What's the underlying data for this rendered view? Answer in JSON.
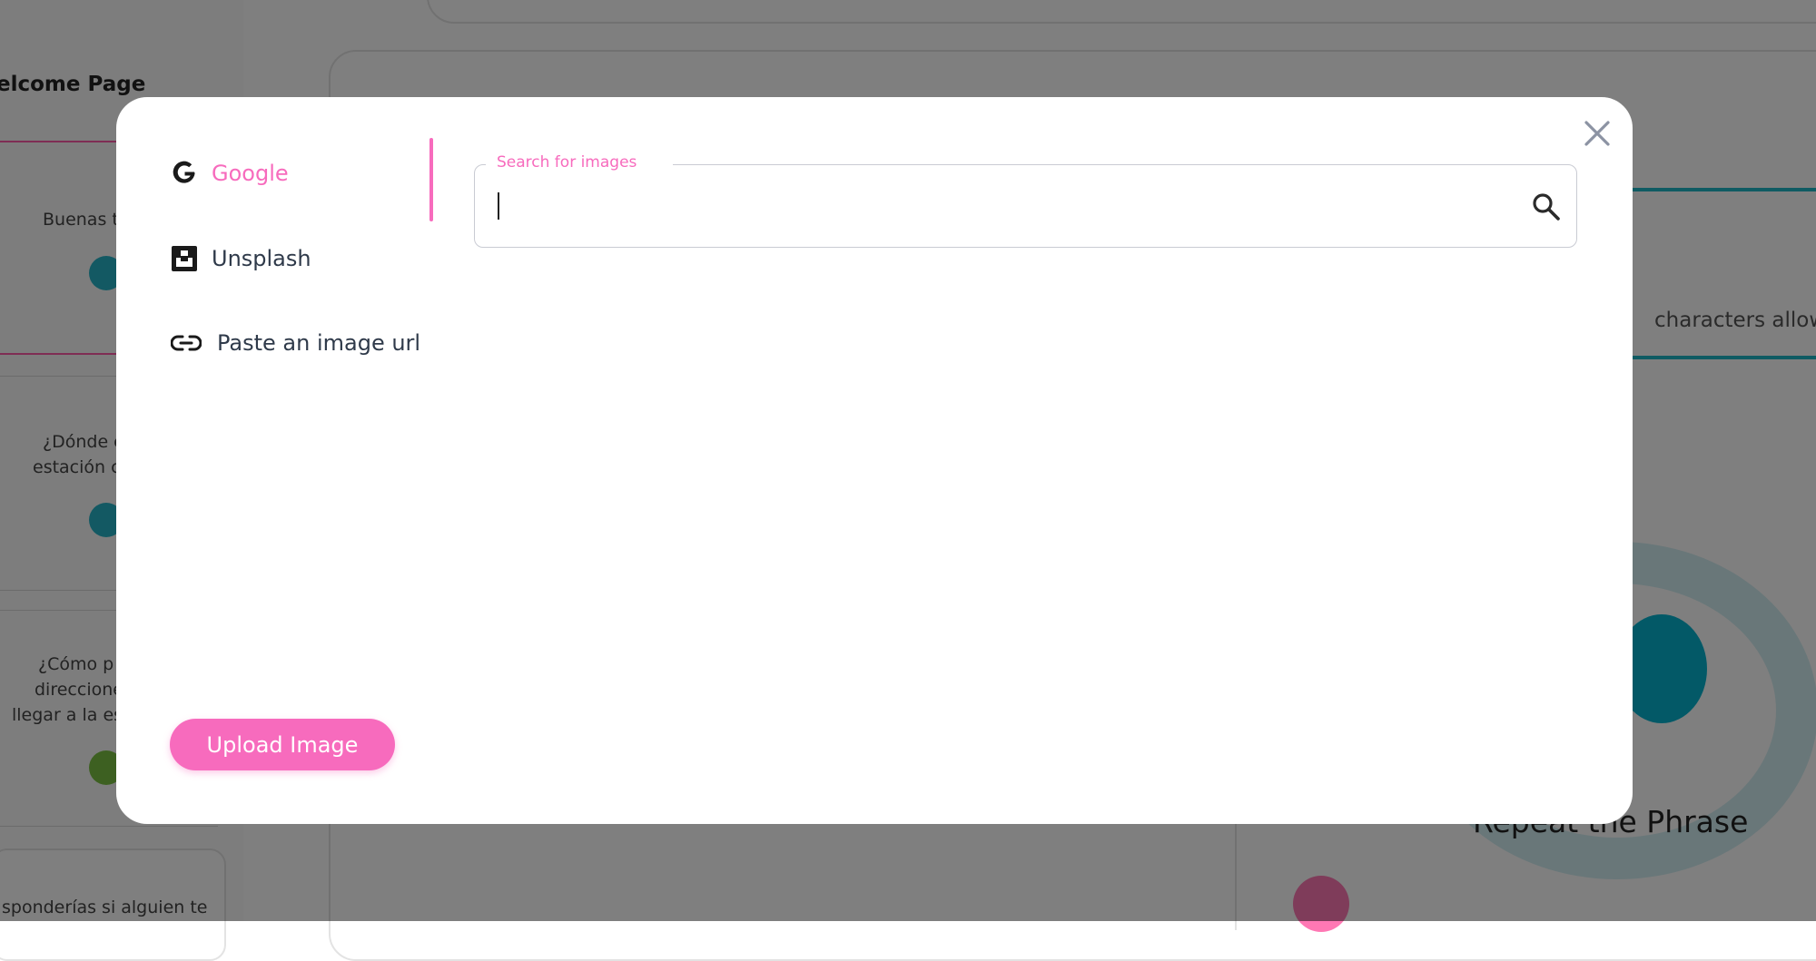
{
  "background": {
    "sidebar_title": "elcome Page",
    "cards": [
      {
        "text": "Buenas t"
      },
      {
        "line1": "¿Dónde e",
        "line2": "estación c"
      },
      {
        "line1": "¿Cómo p",
        "line2": "direccione",
        "line3": "llegar a la es"
      },
      {
        "text": "sponderías si alguien te"
      }
    ],
    "characters_allowed": "characters allow",
    "repeat_phrase": "Repeat the Phrase"
  },
  "modal": {
    "tabs": [
      {
        "label": "Google",
        "icon": "google-icon",
        "active": true
      },
      {
        "label": "Unsplash",
        "icon": "unsplash-icon",
        "active": false
      },
      {
        "label": "Paste an image url",
        "icon": "link-icon",
        "active": false
      }
    ],
    "search": {
      "label": "Search for images",
      "value": ""
    },
    "upload_label": "Upload Image",
    "close_icon": "close-icon"
  },
  "colors": {
    "accent": "#f76bbd",
    "teal": "#1fb6c7",
    "text": "#2f3a4a"
  }
}
